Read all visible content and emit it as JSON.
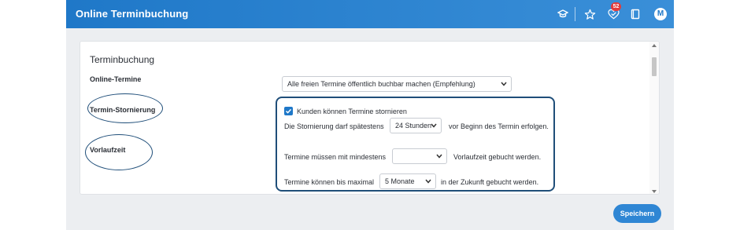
{
  "header": {
    "title": "Online Terminbuchung",
    "notification_count": "52",
    "avatar_initial": "M"
  },
  "card": {
    "title": "Terminbuchung",
    "online_label": "Online-Termine",
    "storno_label": "Termin-Stornierung",
    "vorlauf_label": "Vorlaufzeit"
  },
  "online": {
    "selected": "Alle freien Termine öffentlich buchbar machen (Empfehlung)"
  },
  "storno": {
    "checkbox_label": "Kunden können Termine stornieren",
    "prefix": "Die Stornierung darf spätestens",
    "selected": "24 Stunden",
    "suffix": "vor Beginn des Termin erfolgen."
  },
  "min": {
    "prefix": "Termine müssen mit mindestens",
    "selected": "",
    "suffix": "Vorlaufzeit gebucht werden."
  },
  "max": {
    "prefix": "Termine können bis maximal",
    "selected": "5 Monate",
    "suffix": "in der Zukunft gebucht werden."
  },
  "footer": {
    "save_label": "Speichern"
  },
  "colors": {
    "header": "#1f78c8",
    "accent": "#2f86d4",
    "annotation": "#1f4e79",
    "badge": "#e23b3b"
  }
}
